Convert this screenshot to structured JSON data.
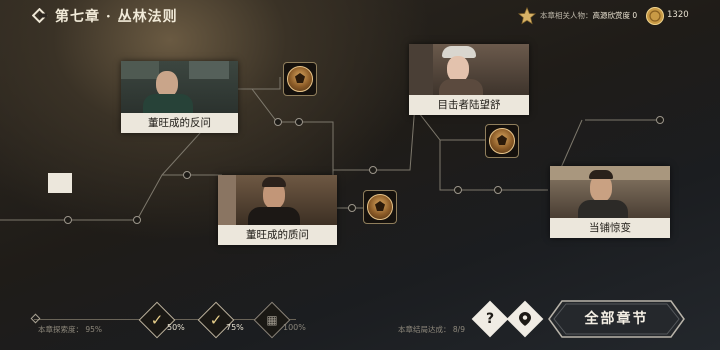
{
  "header": {
    "title": "第七章 · 丛林法则",
    "related_label": "本章相关人物：",
    "related_name": "高源欣赏度",
    "related_value": "0",
    "coins": "1320"
  },
  "nodes": {
    "card1": "董旺成的反问",
    "card2": "董旺成的质问",
    "card3": "目击者陆望舒",
    "card4": "当铺惊变"
  },
  "progress": {
    "milestones": [
      "50%",
      "75%",
      "100%"
    ],
    "explore_label": "本章探索度：",
    "explore_value": "95%",
    "ending_label": "本章结局达成：",
    "ending_value": "8/9"
  },
  "buttons": {
    "help": "?",
    "all_chapters": "全部章节"
  },
  "colors": {
    "accent": "#d6b46a",
    "caption_bg": "#ece7dc",
    "line": "#7d786c"
  }
}
